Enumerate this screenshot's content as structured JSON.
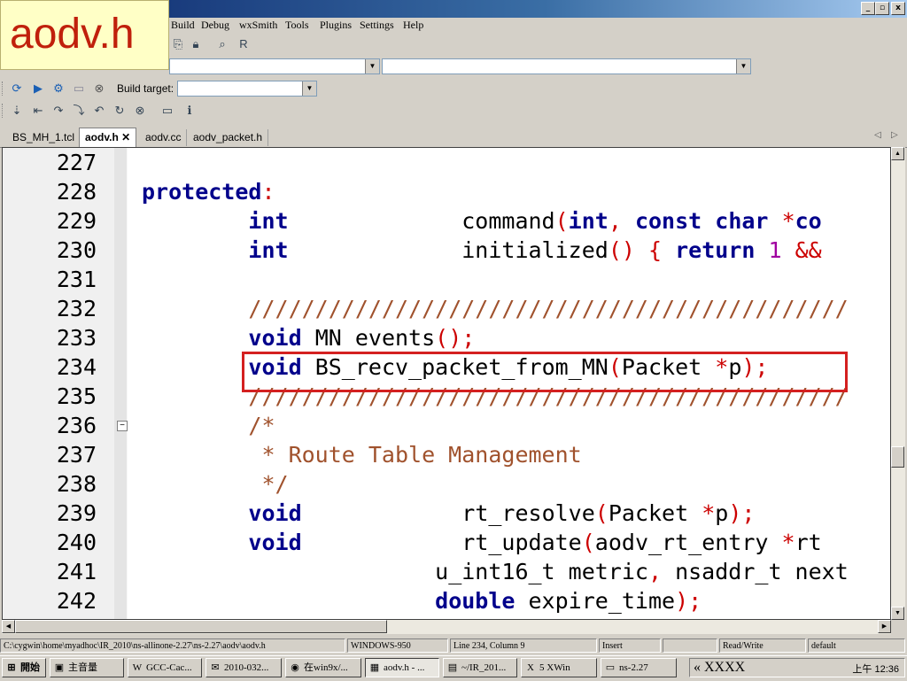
{
  "window": {
    "controls": [
      "_",
      "▫",
      "x"
    ]
  },
  "slide_label": "aodv.h",
  "menu": [
    {
      "label": "Build",
      "key": "build"
    },
    {
      "label": "Debug",
      "key": "debug"
    },
    {
      "label": "wxSmith",
      "key": "wxsmith"
    },
    {
      "label": "Tools",
      "key": "tools"
    },
    {
      "label": "Plugins",
      "key": "plugins"
    },
    {
      "label": "Settings",
      "key": "settings"
    },
    {
      "label": "Help",
      "key": "help"
    }
  ],
  "toolbar": {
    "build_target_label": "Build target:",
    "build_target_value": ""
  },
  "tabs": [
    {
      "label": "BS_MH_1.tcl",
      "active": false
    },
    {
      "label": "aodv.h",
      "active": true,
      "close": "✕"
    },
    {
      "label": "aodv.cc",
      "active": false
    },
    {
      "label": "aodv_packet.h",
      "active": false
    }
  ],
  "code_lines": [
    {
      "n": "227",
      "tokens": []
    },
    {
      "n": "228",
      "tokens": [
        {
          "t": "protected",
          "c": "kw"
        },
        {
          "t": ":",
          "c": "op"
        }
      ]
    },
    {
      "n": "229",
      "tokens": [
        {
          "t": "        "
        },
        {
          "t": "int",
          "c": "kw"
        },
        {
          "t": "             "
        },
        {
          "t": "command"
        },
        {
          "t": "(",
          "c": "op"
        },
        {
          "t": "int",
          "c": "kw"
        },
        {
          "t": ",",
          "c": "op"
        },
        {
          "t": " "
        },
        {
          "t": "const",
          "c": "kw"
        },
        {
          "t": " "
        },
        {
          "t": "char",
          "c": "kw"
        },
        {
          "t": " "
        },
        {
          "t": "*",
          "c": "op"
        },
        {
          "t": "co",
          "c": "kw"
        }
      ]
    },
    {
      "n": "230",
      "tokens": [
        {
          "t": "        "
        },
        {
          "t": "int",
          "c": "kw"
        },
        {
          "t": "             "
        },
        {
          "t": "initialized"
        },
        {
          "t": "()",
          "c": "op"
        },
        {
          "t": " "
        },
        {
          "t": "{",
          "c": "op"
        },
        {
          "t": " "
        },
        {
          "t": "return",
          "c": "kw"
        },
        {
          "t": " "
        },
        {
          "t": "1",
          "c": "num"
        },
        {
          "t": " "
        },
        {
          "t": "&&",
          "c": "op"
        }
      ]
    },
    {
      "n": "231",
      "tokens": []
    },
    {
      "n": "232",
      "tokens": [
        {
          "t": "        "
        },
        {
          "t": "/////////////////////////////////////////////",
          "c": "cm"
        }
      ]
    },
    {
      "n": "233",
      "tokens": [
        {
          "t": "        "
        },
        {
          "t": "void",
          "c": "kw"
        },
        {
          "t": " MN events"
        },
        {
          "t": "();",
          "c": "op"
        }
      ]
    },
    {
      "n": "234",
      "tokens": [
        {
          "t": "        "
        },
        {
          "t": "void",
          "c": "kw"
        },
        {
          "t": " BS_recv_packet_from_MN"
        },
        {
          "t": "(",
          "c": "op"
        },
        {
          "t": "Packet "
        },
        {
          "t": "*",
          "c": "op"
        },
        {
          "t": "p"
        },
        {
          "t": ");",
          "c": "op"
        }
      ]
    },
    {
      "n": "235",
      "tokens": [
        {
          "t": "        "
        },
        {
          "t": "/////////////////////////////////////////////",
          "c": "cm"
        }
      ]
    },
    {
      "n": "236",
      "tokens": [
        {
          "t": "        "
        },
        {
          "t": "/*",
          "c": "cm"
        }
      ]
    },
    {
      "n": "237",
      "tokens": [
        {
          "t": "         "
        },
        {
          "t": "* Route Table Management",
          "c": "cm"
        }
      ]
    },
    {
      "n": "238",
      "tokens": [
        {
          "t": "         "
        },
        {
          "t": "*/",
          "c": "cm"
        }
      ]
    },
    {
      "n": "239",
      "tokens": [
        {
          "t": "        "
        },
        {
          "t": "void",
          "c": "kw"
        },
        {
          "t": "            "
        },
        {
          "t": "rt_resolve"
        },
        {
          "t": "(",
          "c": "op"
        },
        {
          "t": "Packet "
        },
        {
          "t": "*",
          "c": "op"
        },
        {
          "t": "p"
        },
        {
          "t": ");",
          "c": "op"
        }
      ]
    },
    {
      "n": "240",
      "tokens": [
        {
          "t": "        "
        },
        {
          "t": "void",
          "c": "kw"
        },
        {
          "t": "            "
        },
        {
          "t": "rt_update"
        },
        {
          "t": "(",
          "c": "op"
        },
        {
          "t": "aodv_rt_entry "
        },
        {
          "t": "*",
          "c": "op"
        },
        {
          "t": "rt"
        }
      ]
    },
    {
      "n": "241",
      "tokens": [
        {
          "t": "                      "
        },
        {
          "t": "u_int16_t metric"
        },
        {
          "t": ",",
          "c": "op"
        },
        {
          "t": " nsaddr_t next"
        }
      ]
    },
    {
      "n": "242",
      "tokens": [
        {
          "t": "                      "
        },
        {
          "t": "double",
          "c": "kw"
        },
        {
          "t": " expire_time"
        },
        {
          "t": ");",
          "c": "op"
        }
      ]
    }
  ],
  "status": {
    "path": "C:\\cygwin\\home\\myadhoc\\IR_2010\\ns-allinone-2.27\\ns-2.27\\aodv\\aodv.h",
    "encoding": "WINDOWS-950",
    "position": "Line 234, Column 9",
    "mode": "Insert",
    "blank": "",
    "access": "Read/Write",
    "profile": "default"
  },
  "taskbar": {
    "start_label": "開始",
    "buttons": [
      {
        "label": "主音量",
        "icon": "▣"
      },
      {
        "label": "GCC-Cac...",
        "icon": "W"
      },
      {
        "label": "2010-032...",
        "icon": "✉"
      },
      {
        "label": "在win9x/...",
        "icon": "◉"
      },
      {
        "label": "aodv.h - ...",
        "icon": "▦",
        "active": true
      },
      {
        "label": "~/IR_201...",
        "icon": "▤"
      },
      {
        "label": "5 XWin",
        "icon": "X"
      },
      {
        "label": "ns-2.27",
        "icon": "▭"
      }
    ],
    "tray_text": "« XXXX",
    "clock": "上午 12:36"
  }
}
